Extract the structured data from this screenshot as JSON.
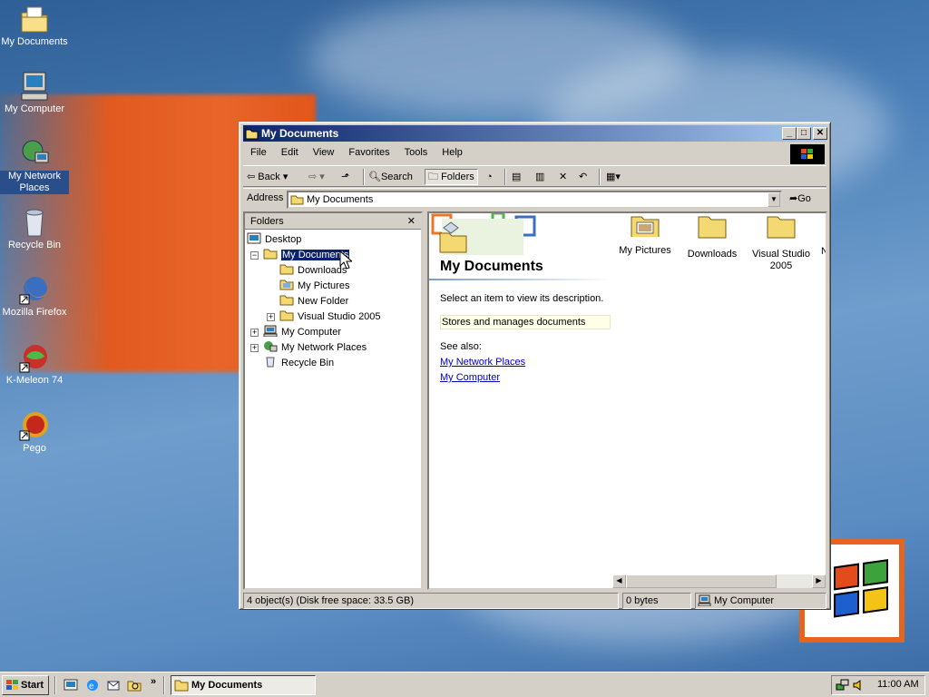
{
  "desktop": {
    "icons": [
      {
        "label": "My Documents",
        "icon": "my-documents-icon"
      },
      {
        "label": "My Computer",
        "icon": "my-computer-icon"
      },
      {
        "label": "My Network Places",
        "icon": "network-icon"
      },
      {
        "label": "Recycle Bin",
        "icon": "recycle-bin-icon"
      },
      {
        "label": "Mozilla Firefox",
        "icon": "firefox-icon"
      },
      {
        "label": "K-Meleon 74",
        "icon": "kmeleon-icon"
      },
      {
        "label": "Pego",
        "icon": "pego-icon"
      }
    ]
  },
  "window": {
    "title": "My Documents",
    "menu": [
      "File",
      "Edit",
      "View",
      "Favorites",
      "Tools",
      "Help"
    ],
    "toolbar": {
      "back": "Back",
      "search": "Search",
      "folders": "Folders"
    },
    "address": {
      "label": "Address",
      "value": "My Documents",
      "go": "Go"
    },
    "folders_pane": {
      "title": "Folders",
      "close": "✕",
      "tree": [
        {
          "label": "Desktop",
          "level": 0,
          "icon": "desktop-icon"
        },
        {
          "label": "My Documents",
          "level": 1,
          "selected": true,
          "icon": "folder-open-icon"
        },
        {
          "label": "Downloads",
          "level": 2,
          "icon": "folder-icon"
        },
        {
          "label": "My Pictures",
          "level": 2,
          "icon": "pictures-folder-icon"
        },
        {
          "label": "New Folder",
          "level": 2,
          "icon": "folder-icon"
        },
        {
          "label": "Visual Studio 2005",
          "level": 2,
          "icon": "folder-icon"
        },
        {
          "label": "My Computer",
          "level": 1,
          "icon": "computer-icon"
        },
        {
          "label": "My Network Places",
          "level": 1,
          "icon": "network-icon"
        },
        {
          "label": "Recycle Bin",
          "level": 1,
          "icon": "recycle-bin-icon"
        }
      ]
    },
    "webview": {
      "heading": "My Documents",
      "prompt": "Select an item to view its description.",
      "desc": "Stores and manages documents",
      "see_also": "See also:",
      "links": [
        "My Network Places",
        "My Computer"
      ]
    },
    "items": [
      {
        "label": "My Pictures"
      },
      {
        "label": "Downloads"
      },
      {
        "label": "Visual Studio 2005"
      }
    ],
    "status": {
      "objects": "4 object(s) (Disk free space: 33.5 GB)",
      "size": "0 bytes",
      "zone": "My Computer"
    }
  },
  "taskbar": {
    "start": "Start",
    "task": "My Documents",
    "clock": "11:00 AM"
  },
  "colors": {
    "desktop": "#3a6ea5",
    "title_active": "#0a246a",
    "selection": "#0a246a",
    "accent_orange": "#e25a1f"
  }
}
